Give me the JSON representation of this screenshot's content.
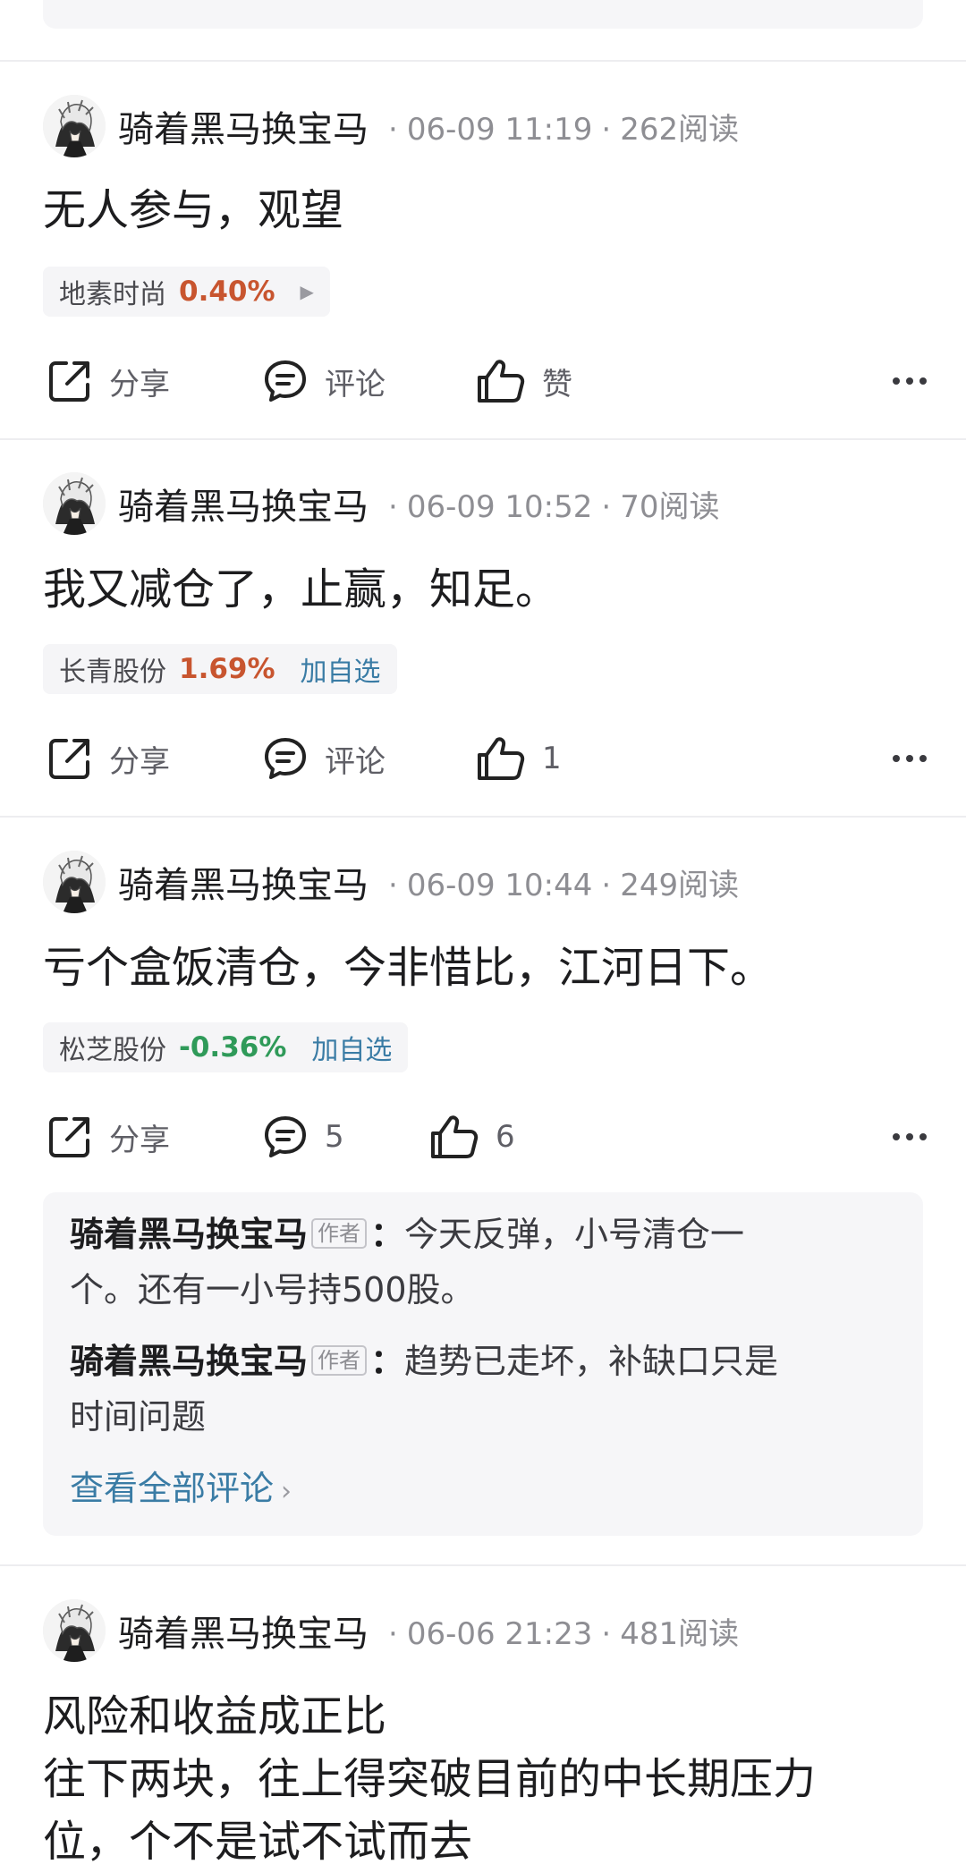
{
  "colors": {
    "accent": "#3a7ca5",
    "up": "#c8552f",
    "down": "#2f9a59",
    "muted": "#8e8e93"
  },
  "actions_labels": {
    "share": "分享",
    "comment": "评论",
    "like": "赞"
  },
  "posts": [
    {
      "author": "骑着黑马换宝马",
      "date": "06-09 11:19",
      "reads": "262阅读",
      "text": [
        "无人参与，观望"
      ],
      "stock": {
        "name": "地素时尚",
        "change": "0.40%",
        "direction": "up",
        "add_label": ""
      },
      "comment_count": "",
      "like_count": ""
    },
    {
      "author": "骑着黑马换宝马",
      "date": "06-09 10:52",
      "reads": "70阅读",
      "text": [
        "我又减仓了，止赢，知足。"
      ],
      "stock": {
        "name": "长青股份",
        "change": "1.69%",
        "direction": "up",
        "add_label": "加自选"
      },
      "comment_count": "",
      "like_count": "1"
    },
    {
      "author": "骑着黑马换宝马",
      "date": "06-09 10:44",
      "reads": "249阅读",
      "text": [
        "亏个盒饭清仓，今非惜比，江河日下。"
      ],
      "stock": {
        "name": "松芝股份",
        "change": "-0.36%",
        "direction": "down",
        "add_label": "加自选"
      },
      "comment_count": "5",
      "like_count": "6",
      "comments": [
        {
          "author": "骑着黑马换宝马",
          "badge": "作者",
          "colon": "：",
          "line1": "今天反弹，小号清仓一",
          "line2": "个。还有一小号持500股。"
        },
        {
          "author": "骑着黑马换宝马",
          "badge": "作者",
          "colon": "：",
          "line1": "趋势已走坏，补缺口只是",
          "line2": "时间问题"
        }
      ],
      "view_all": "查看全部评论"
    },
    {
      "author": "骑着黑马换宝马",
      "date": "06-06 21:23",
      "reads": "481阅读",
      "text": [
        "风险和收益成正比",
        "往下两块，往上得突破目前的中长期压力",
        "位，个不是试不试而去"
      ]
    }
  ]
}
